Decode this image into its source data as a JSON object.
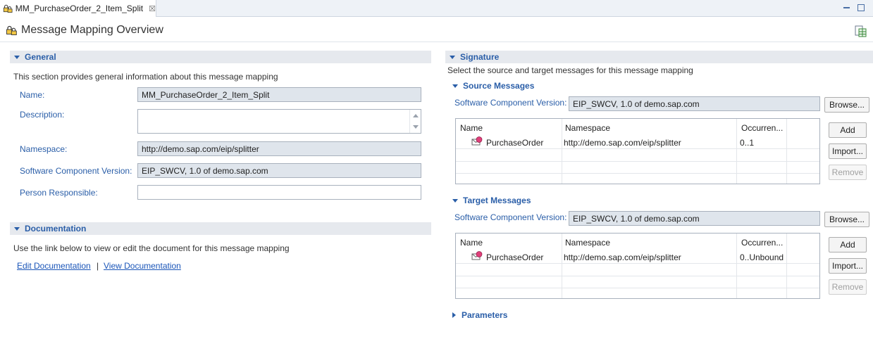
{
  "tab": {
    "title": "MM_PurchaseOrder_2_Item_Split",
    "close": "☒"
  },
  "header": {
    "title": "Message Mapping Overview"
  },
  "general": {
    "heading": "General",
    "description": "This section provides general information about this message mapping",
    "fields": {
      "name_label": "Name:",
      "name_value": "MM_PurchaseOrder_2_Item_Split",
      "description_label": "Description:",
      "description_value": "",
      "namespace_label": "Namespace:",
      "namespace_value": "http://demo.sap.com/eip/splitter",
      "swcv_label": "Software Component Version:",
      "swcv_value": "EIP_SWCV, 1.0 of demo.sap.com",
      "person_label": "Person Responsible:",
      "person_value": ""
    }
  },
  "documentation": {
    "heading": "Documentation",
    "description": "Use the link below to view or edit the document for this message mapping",
    "edit_link": "Edit Documentation",
    "separator": "|",
    "view_link": "View Documentation"
  },
  "signature": {
    "heading": "Signature",
    "description": "Select the source and target messages for this message mapping",
    "source": {
      "heading": "Source Messages",
      "swcv_label": "Software Component Version:",
      "swcv_value": "EIP_SWCV, 1.0 of demo.sap.com",
      "browse": "Browse...",
      "columns": {
        "name": "Name",
        "namespace": "Namespace",
        "occurrence": "Occurren..."
      },
      "rows": [
        {
          "name": "PurchaseOrder",
          "namespace": "http://demo.sap.com/eip/splitter",
          "occurrence": "0..1"
        }
      ],
      "add": "Add",
      "import": "Import...",
      "remove": "Remove"
    },
    "target": {
      "heading": "Target Messages",
      "swcv_label": "Software Component Version:",
      "swcv_value": "EIP_SWCV, 1.0 of demo.sap.com",
      "browse": "Browse...",
      "columns": {
        "name": "Name",
        "namespace": "Namespace",
        "occurrence": "Occurren..."
      },
      "rows": [
        {
          "name": "PurchaseOrder",
          "namespace": "http://demo.sap.com/eip/splitter",
          "occurrence": "0..Unbound"
        }
      ],
      "add": "Add",
      "import": "Import...",
      "remove": "Remove"
    },
    "parameters": {
      "heading": "Parameters"
    }
  },
  "colors": {
    "accent": "#2a5ea8",
    "link": "#1a55b8",
    "section_bg": "#e6e9ee",
    "field_bg": "#dfe5ec"
  },
  "icons": {
    "tab": "lock-mapping-icon",
    "header": "lock-mapping-icon",
    "toolbar": "spreadsheet-icon",
    "message": "message-icon"
  }
}
